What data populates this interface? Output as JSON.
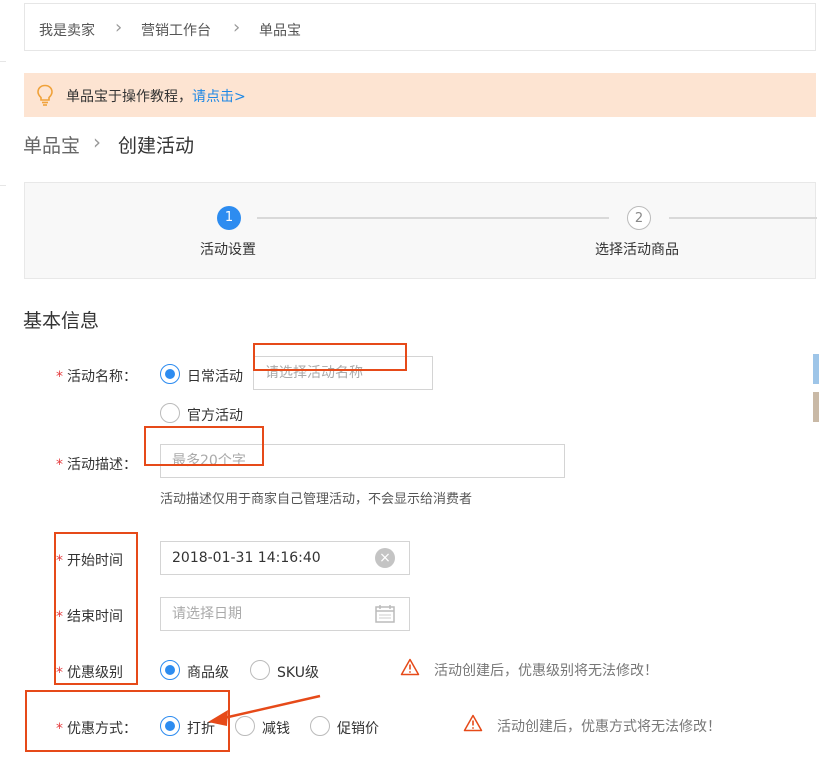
{
  "breadcrumb": [
    "我是卖家",
    "营销工作台",
    "单品宝"
  ],
  "notice": {
    "text": "单品宝于操作教程，",
    "link": "请点击>"
  },
  "page_title": {
    "parent": "单品宝",
    "current": "创建活动"
  },
  "steps": [
    {
      "number": "1",
      "label": "活动设置",
      "active": true
    },
    {
      "number": "2",
      "label": "选择活动商品",
      "active": false
    }
  ],
  "section_title": "基本信息",
  "form": {
    "activity_name": {
      "label": "活动名称：",
      "options": [
        "日常活动",
        "官方活动"
      ],
      "selected": "日常活动",
      "placeholder": "请选择活动名称"
    },
    "activity_desc": {
      "label": "活动描述：",
      "placeholder": "最多20个字",
      "hint": "活动描述仅用于商家自己管理活动，不会显示给消费者"
    },
    "start_time": {
      "label": "开始时间",
      "value": "2018-01-31 14:16:40"
    },
    "end_time": {
      "label": "结束时间",
      "placeholder": "请选择日期"
    },
    "discount_level": {
      "label": "优惠级别",
      "options": [
        "商品级",
        "SKU级"
      ],
      "selected": "商品级",
      "warning": "活动创建后，优惠级别将无法修改！"
    },
    "discount_method": {
      "label": "优惠方式：",
      "options": [
        "打折",
        "减钱",
        "促销价"
      ],
      "selected": "打折",
      "warning": "活动创建后，优惠方式将无法修改！"
    }
  },
  "colors": {
    "accent": "#2d8cf0",
    "required_star": "#e4393c",
    "annotation": "#e64a19",
    "notice_bg": "#fde4d2",
    "link": "#1e88e5"
  }
}
